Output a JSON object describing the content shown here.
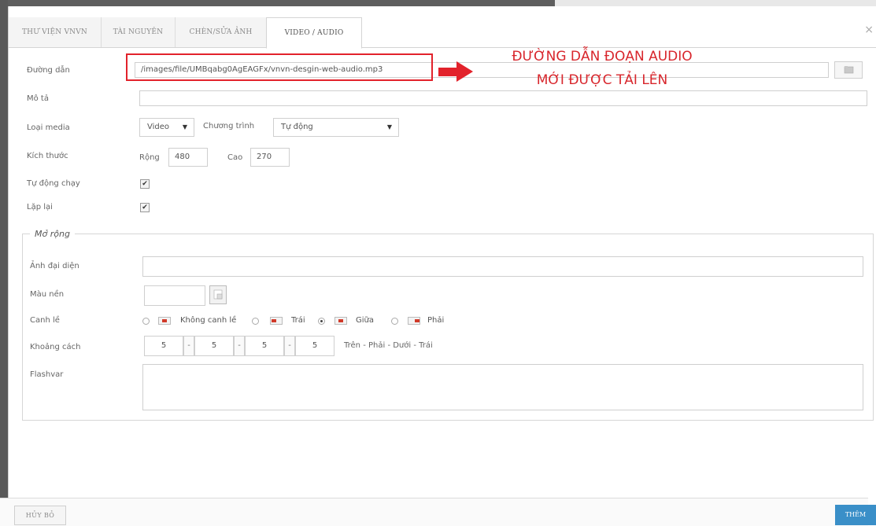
{
  "tabs": [
    {
      "label": "THƯ VIỆN VNVN",
      "active": false
    },
    {
      "label": "TÀI NGUYÊN",
      "active": false
    },
    {
      "label": "CHÈN/SỬA ẢNH",
      "active": false
    },
    {
      "label": "VIDEO / AUDIO",
      "active": true
    }
  ],
  "close_label": "×",
  "path": {
    "label": "Đường dẫn",
    "value": "/images/file/UMBqabg0AgEAGFx/vnvn-desgin-web-audio.mp3"
  },
  "description": {
    "label": "Mô tả",
    "value": ""
  },
  "media_type": {
    "label": "Loại media",
    "selected": "Video",
    "program_label": "Chương trình",
    "program_selected": "Tự động"
  },
  "size": {
    "label": "Kích thước",
    "width_label": "Rộng",
    "width": "480",
    "height_label": "Cao",
    "height": "270"
  },
  "autoplay": {
    "label": "Tự động chạy",
    "checked": true,
    "mark": "✔"
  },
  "loop": {
    "label": "Lặp lại",
    "checked": true,
    "mark": "✔"
  },
  "annotation": {
    "line1": "ĐƯỜNG DẪN ĐOẠN AUDIO",
    "line2": "MỚI ĐƯỢC TẢI LÊN",
    "color": "#d8262c"
  },
  "extended": {
    "legend": "Mở rộng",
    "thumbnail_label": "Ảnh đại diện",
    "bgcolor_label": "Màu nền",
    "align_label": "Canh lề",
    "align_options": [
      {
        "label": "Không canh lề",
        "selected": false
      },
      {
        "label": "Trái",
        "selected": false
      },
      {
        "label": "Giữa",
        "selected": true
      },
      {
        "label": "Phải",
        "selected": false
      }
    ],
    "spacing_label": "Khoảng cách",
    "spacing_values": [
      "5",
      "5",
      "5",
      "5"
    ],
    "spacing_separator": "-",
    "spacing_hint": "Trên - Phải - Dưới - Trái",
    "flashvar_label": "Flashvar"
  },
  "footer": {
    "cancel_label": "HỦY BỎ",
    "add_label": "THÊM"
  },
  "colors": {
    "accent": "#3a8fc8",
    "highlight": "#e2222b"
  }
}
